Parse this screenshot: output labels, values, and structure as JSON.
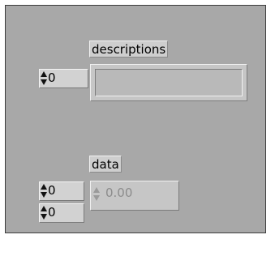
{
  "descriptions_array": {
    "label": "descriptions",
    "index": "0",
    "element_value": ""
  },
  "data_array": {
    "label": "data",
    "index_row": "0",
    "index_col": "0",
    "element_value": "0.00"
  },
  "icons": {
    "index_spinner": "up-down-arrows-icon",
    "numeric_spinner_disabled": "up-down-arrows-icon"
  },
  "colors": {
    "panel_background": "#a8a8a8",
    "control_face": "#d2d2d2",
    "disabled_text": "#8c8c8c"
  }
}
